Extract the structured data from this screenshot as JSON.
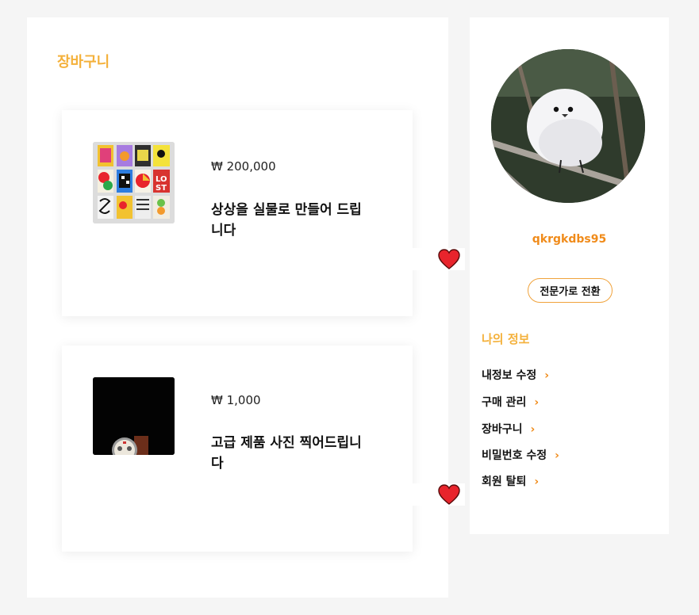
{
  "cart": {
    "title": "장바구니",
    "items": [
      {
        "price": "₩ 200,000",
        "title": "상상을 실물로 만들어 드립니다",
        "image": "poster-collage-thumbnail"
      },
      {
        "price": "₩ 1,000",
        "title": "고급 제품 사진 찍어드립니다",
        "image": "watch-photo-thumbnail"
      }
    ]
  },
  "profile": {
    "avatar": "white-bird-avatar",
    "username": "qkrgkdbs95",
    "switch_label": "전문가로 전환",
    "section_title": "나의 정보",
    "menu": [
      {
        "label": "내정보 수정"
      },
      {
        "label": "구매 관리"
      },
      {
        "label": "장바구니"
      },
      {
        "label": "비밀번호 수정"
      },
      {
        "label": "회원 탈퇴"
      }
    ]
  },
  "icons": {
    "heart": "heart-icon",
    "chevron": "chevron-right-icon"
  },
  "colors": {
    "accent": "#f4b13b",
    "accent_dark": "#f08b1a",
    "heart": "#e8242c"
  }
}
